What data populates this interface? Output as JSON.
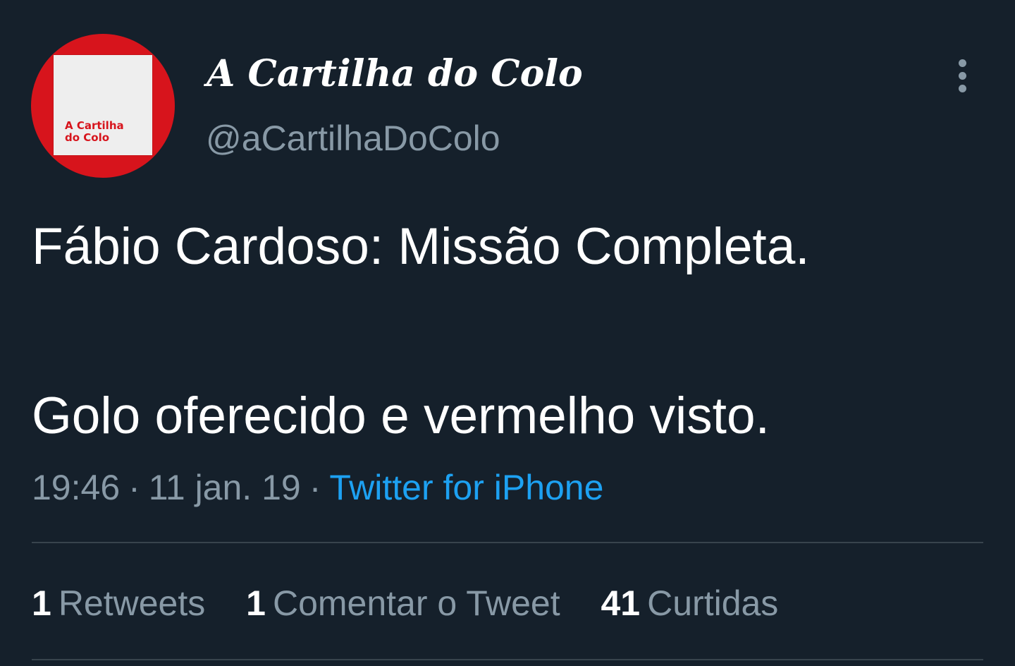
{
  "account": {
    "display_name": "A Cartilha do Colo",
    "handle": "@aCartilhaDoColo",
    "avatar_text_line1": "A Cartilha",
    "avatar_text_line2": "do Colo"
  },
  "menu": {
    "icon": "more-vertical-icon"
  },
  "tweet": {
    "line1": "Fábio Cardoso: Missão Completa.",
    "line2": "Golo oferecido e vermelho visto."
  },
  "meta": {
    "time": "19:46",
    "separator": "·",
    "date": "11 jan. 19",
    "source": "Twitter for iPhone"
  },
  "stats": [
    {
      "count": "1",
      "label": "Retweets"
    },
    {
      "count": "1",
      "label": "Comentar o Tweet"
    },
    {
      "count": "41",
      "label": "Curtidas"
    }
  ],
  "colors": {
    "background": "#15202b",
    "primary_text": "#ffffff",
    "secondary_text": "#8899a6",
    "link": "#1da1f2",
    "divider": "#38444d",
    "avatar_red": "#d7141c"
  }
}
